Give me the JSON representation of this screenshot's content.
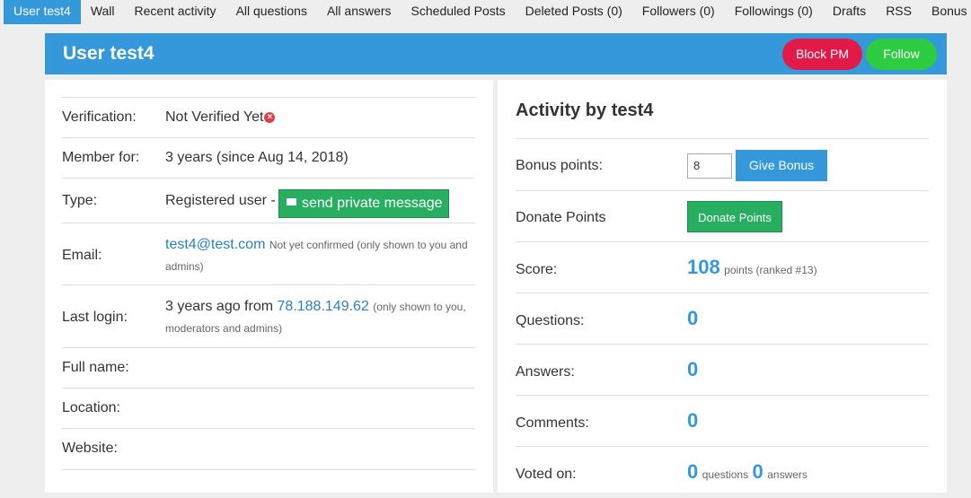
{
  "nav": {
    "tabs": [
      {
        "label": "User test4",
        "active": true
      },
      {
        "label": "Wall"
      },
      {
        "label": "Recent activity"
      },
      {
        "label": "All questions"
      },
      {
        "label": "All answers"
      },
      {
        "label": "Scheduled Posts"
      },
      {
        "label": "Deleted Posts (0)"
      },
      {
        "label": "Followers (0)"
      },
      {
        "label": "Followings (0)"
      },
      {
        "label": "Drafts"
      },
      {
        "label": "RSS"
      },
      {
        "label": "Bonus Records"
      }
    ]
  },
  "header": {
    "title": "User test4",
    "block_pm_label": "Block PM",
    "follow_label": "Follow"
  },
  "profile": {
    "verification_label": "Verification:",
    "verification_value": "Not Verified Yet",
    "member_label": "Member for:",
    "member_value": "3 years (since Aug 14, 2018)",
    "type_label": "Type:",
    "type_value": "Registered user -",
    "pm_button": "send private message",
    "email_label": "Email:",
    "email_value": "test4@test.com",
    "email_note": "Not yet confirmed (only shown to you and admins)",
    "login_label": "Last login:",
    "login_value": "3 years ago from",
    "login_ip": "78.188.149.62",
    "login_note": "(only shown to you, moderators and admins)",
    "fullname_label": "Full name:",
    "location_label": "Location:",
    "website_label": "Website:"
  },
  "activity": {
    "title": "Activity by test4",
    "bonus_label": "Bonus points:",
    "bonus_input_value": "8",
    "give_bonus_label": "Give Bonus",
    "donate_label": "Donate Points",
    "donate_button": "Donate Points",
    "score_label": "Score:",
    "score_value": "108",
    "score_note": "points (ranked #13)",
    "questions_label": "Questions:",
    "questions_value": "0",
    "answers_label": "Answers:",
    "answers_value": "0",
    "comments_label": "Comments:",
    "comments_value": "0",
    "voted_label": "Voted on:",
    "voted_questions": "0",
    "voted_questions_unit": "questions",
    "voted_answers": "0",
    "voted_answers_unit": "answers"
  },
  "colors": {
    "accent": "#3498db",
    "block_pm": "#e21a4a",
    "follow": "#2ecc40",
    "pm_button": "#27ae60"
  }
}
